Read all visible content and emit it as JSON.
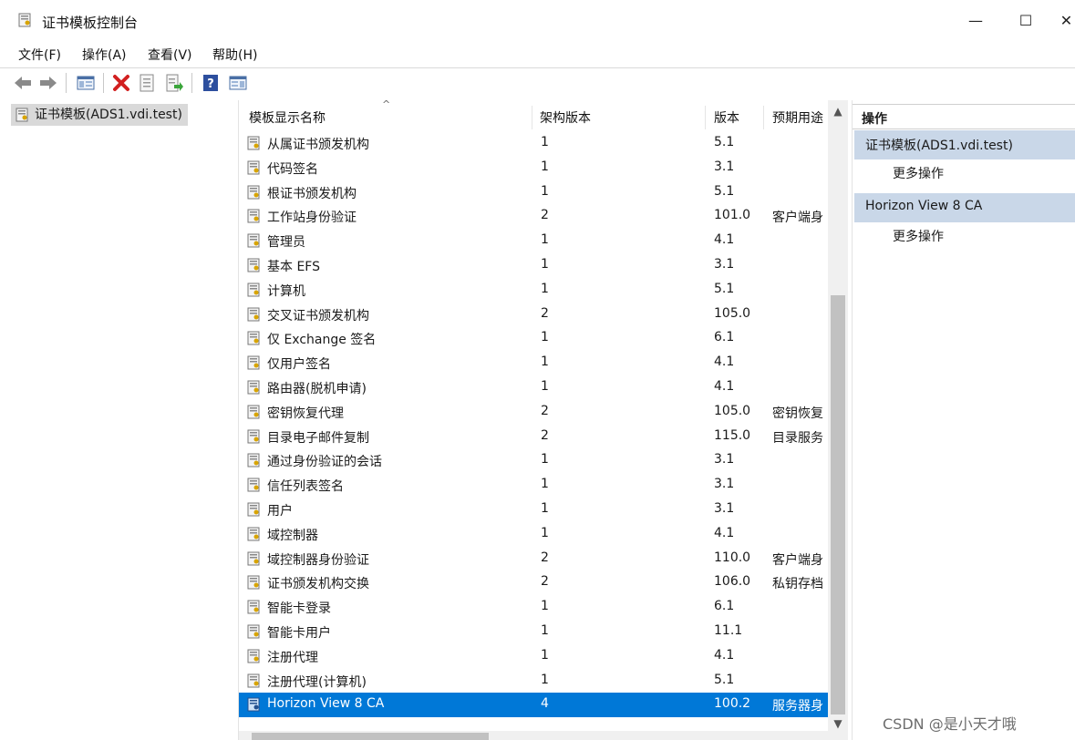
{
  "window": {
    "title": "证书模板控制台",
    "minimize": "—",
    "maximize": "☐",
    "close": "✕"
  },
  "menu": [
    "文件(F)",
    "操作(A)",
    "查看(V)",
    "帮助(H)"
  ],
  "tree": {
    "root": "证书模板(ADS1.vdi.test)"
  },
  "list": {
    "columns": [
      "模板显示名称",
      "架构版本",
      "版本",
      "预期用途"
    ],
    "rows": [
      {
        "name": "从属证书颁发机构",
        "arch": "1",
        "ver": "5.1",
        "use": ""
      },
      {
        "name": "代码签名",
        "arch": "1",
        "ver": "3.1",
        "use": ""
      },
      {
        "name": "根证书颁发机构",
        "arch": "1",
        "ver": "5.1",
        "use": ""
      },
      {
        "name": "工作站身份验证",
        "arch": "2",
        "ver": "101.0",
        "use": "客户端身"
      },
      {
        "name": "管理员",
        "arch": "1",
        "ver": "4.1",
        "use": ""
      },
      {
        "name": "基本 EFS",
        "arch": "1",
        "ver": "3.1",
        "use": ""
      },
      {
        "name": "计算机",
        "arch": "1",
        "ver": "5.1",
        "use": ""
      },
      {
        "name": "交叉证书颁发机构",
        "arch": "2",
        "ver": "105.0",
        "use": ""
      },
      {
        "name": "仅 Exchange 签名",
        "arch": "1",
        "ver": "6.1",
        "use": ""
      },
      {
        "name": "仅用户签名",
        "arch": "1",
        "ver": "4.1",
        "use": ""
      },
      {
        "name": "路由器(脱机申请)",
        "arch": "1",
        "ver": "4.1",
        "use": ""
      },
      {
        "name": "密钥恢复代理",
        "arch": "2",
        "ver": "105.0",
        "use": "密钥恢复"
      },
      {
        "name": "目录电子邮件复制",
        "arch": "2",
        "ver": "115.0",
        "use": "目录服务"
      },
      {
        "name": "通过身份验证的会话",
        "arch": "1",
        "ver": "3.1",
        "use": ""
      },
      {
        "name": "信任列表签名",
        "arch": "1",
        "ver": "3.1",
        "use": ""
      },
      {
        "name": "用户",
        "arch": "1",
        "ver": "3.1",
        "use": ""
      },
      {
        "name": "域控制器",
        "arch": "1",
        "ver": "4.1",
        "use": ""
      },
      {
        "name": "域控制器身份验证",
        "arch": "2",
        "ver": "110.0",
        "use": "客户端身"
      },
      {
        "name": "证书颁发机构交换",
        "arch": "2",
        "ver": "106.0",
        "use": "私钥存档"
      },
      {
        "name": "智能卡登录",
        "arch": "1",
        "ver": "6.1",
        "use": ""
      },
      {
        "name": "智能卡用户",
        "arch": "1",
        "ver": "11.1",
        "use": ""
      },
      {
        "name": "注册代理",
        "arch": "1",
        "ver": "4.1",
        "use": ""
      },
      {
        "name": "注册代理(计算机)",
        "arch": "1",
        "ver": "5.1",
        "use": ""
      },
      {
        "name": "Horizon View 8 CA",
        "arch": "4",
        "ver": "100.2",
        "use": "服务器身",
        "selected": true
      }
    ]
  },
  "actions": {
    "header": "操作",
    "sections": [
      {
        "title": "证书模板(ADS1.vdi.test)",
        "link": "更多操作"
      },
      {
        "title": "Horizon View 8 CA",
        "link": "更多操作"
      }
    ]
  },
  "watermark": "CSDN @是小天才哦",
  "colors": {
    "selection": "#0078d7",
    "action_section": "#c9d7e8"
  }
}
